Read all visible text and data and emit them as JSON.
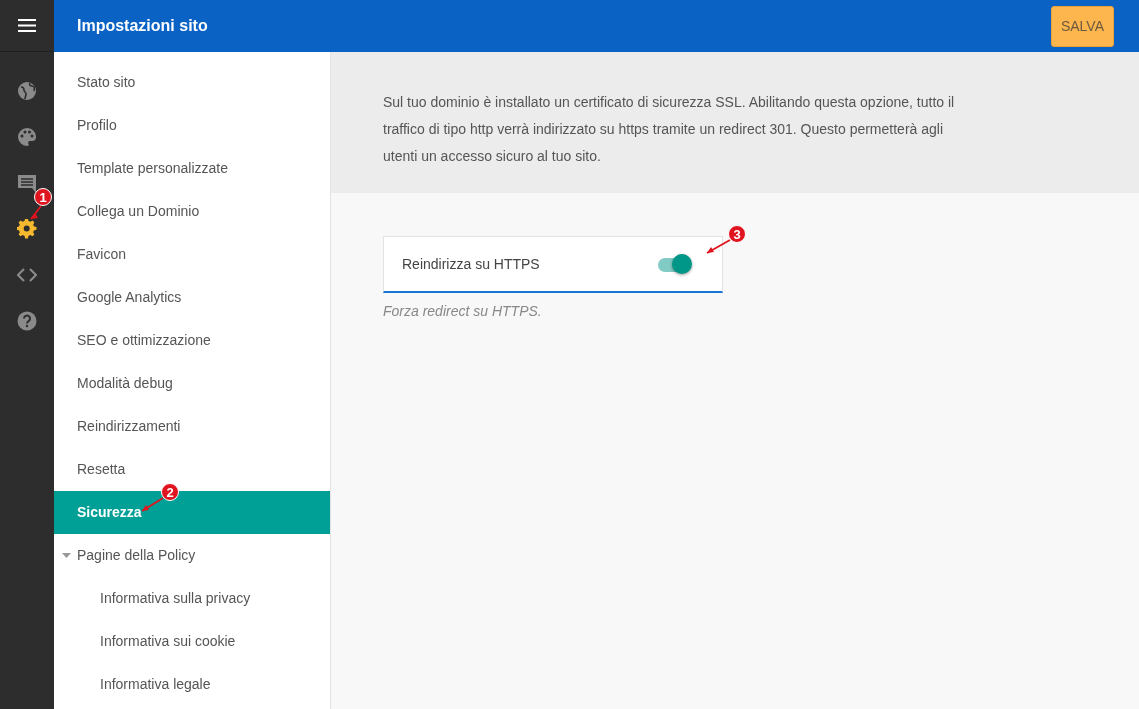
{
  "rail": {
    "items": [
      {
        "kind": "globe",
        "selected": false
      },
      {
        "kind": "palette",
        "selected": false
      },
      {
        "kind": "comment",
        "selected": false
      },
      {
        "kind": "gear",
        "selected": true
      },
      {
        "kind": "code",
        "selected": false
      },
      {
        "kind": "help",
        "selected": false
      }
    ]
  },
  "header": {
    "title": "Impostazioni sito",
    "save_button": "SALVA"
  },
  "sidebar": {
    "items": [
      {
        "label": "Stato sito",
        "selected": false
      },
      {
        "label": "Profilo",
        "selected": false
      },
      {
        "label": "Template personalizzate",
        "selected": false
      },
      {
        "label": "Collega un Dominio",
        "selected": false
      },
      {
        "label": "Favicon",
        "selected": false
      },
      {
        "label": "Google Analytics",
        "selected": false
      },
      {
        "label": "SEO e ottimizzazione",
        "selected": false
      },
      {
        "label": "Modalità debug",
        "selected": false
      },
      {
        "label": "Reindirizzamenti",
        "selected": false
      },
      {
        "label": "Resetta",
        "selected": false
      },
      {
        "label": "Sicurezza",
        "selected": true
      },
      {
        "label": "Pagine della Policy",
        "selected": false,
        "expanded": true,
        "children": [
          {
            "label": "Informativa sulla privacy",
            "selected": false
          },
          {
            "label": "Informativa sui cookie",
            "selected": false
          },
          {
            "label": "Informativa legale",
            "selected": false
          }
        ]
      }
    ]
  },
  "content": {
    "description": "Sul tuo dominio è installato un certificato di sicurezza SSL. Abilitando questa opzione, tutto il traffico di tipo http verrà indirizzato su https tramite un redirect 301. Questo permetterà agli utenti un accesso sicuro al tuo sito.",
    "setting": {
      "label": "Reindirizza su HTTPS",
      "on": true,
      "help": "Forza redirect su HTTPS."
    }
  },
  "annotations": [
    {
      "number": "1"
    },
    {
      "number": "2"
    },
    {
      "number": "3"
    }
  ]
}
